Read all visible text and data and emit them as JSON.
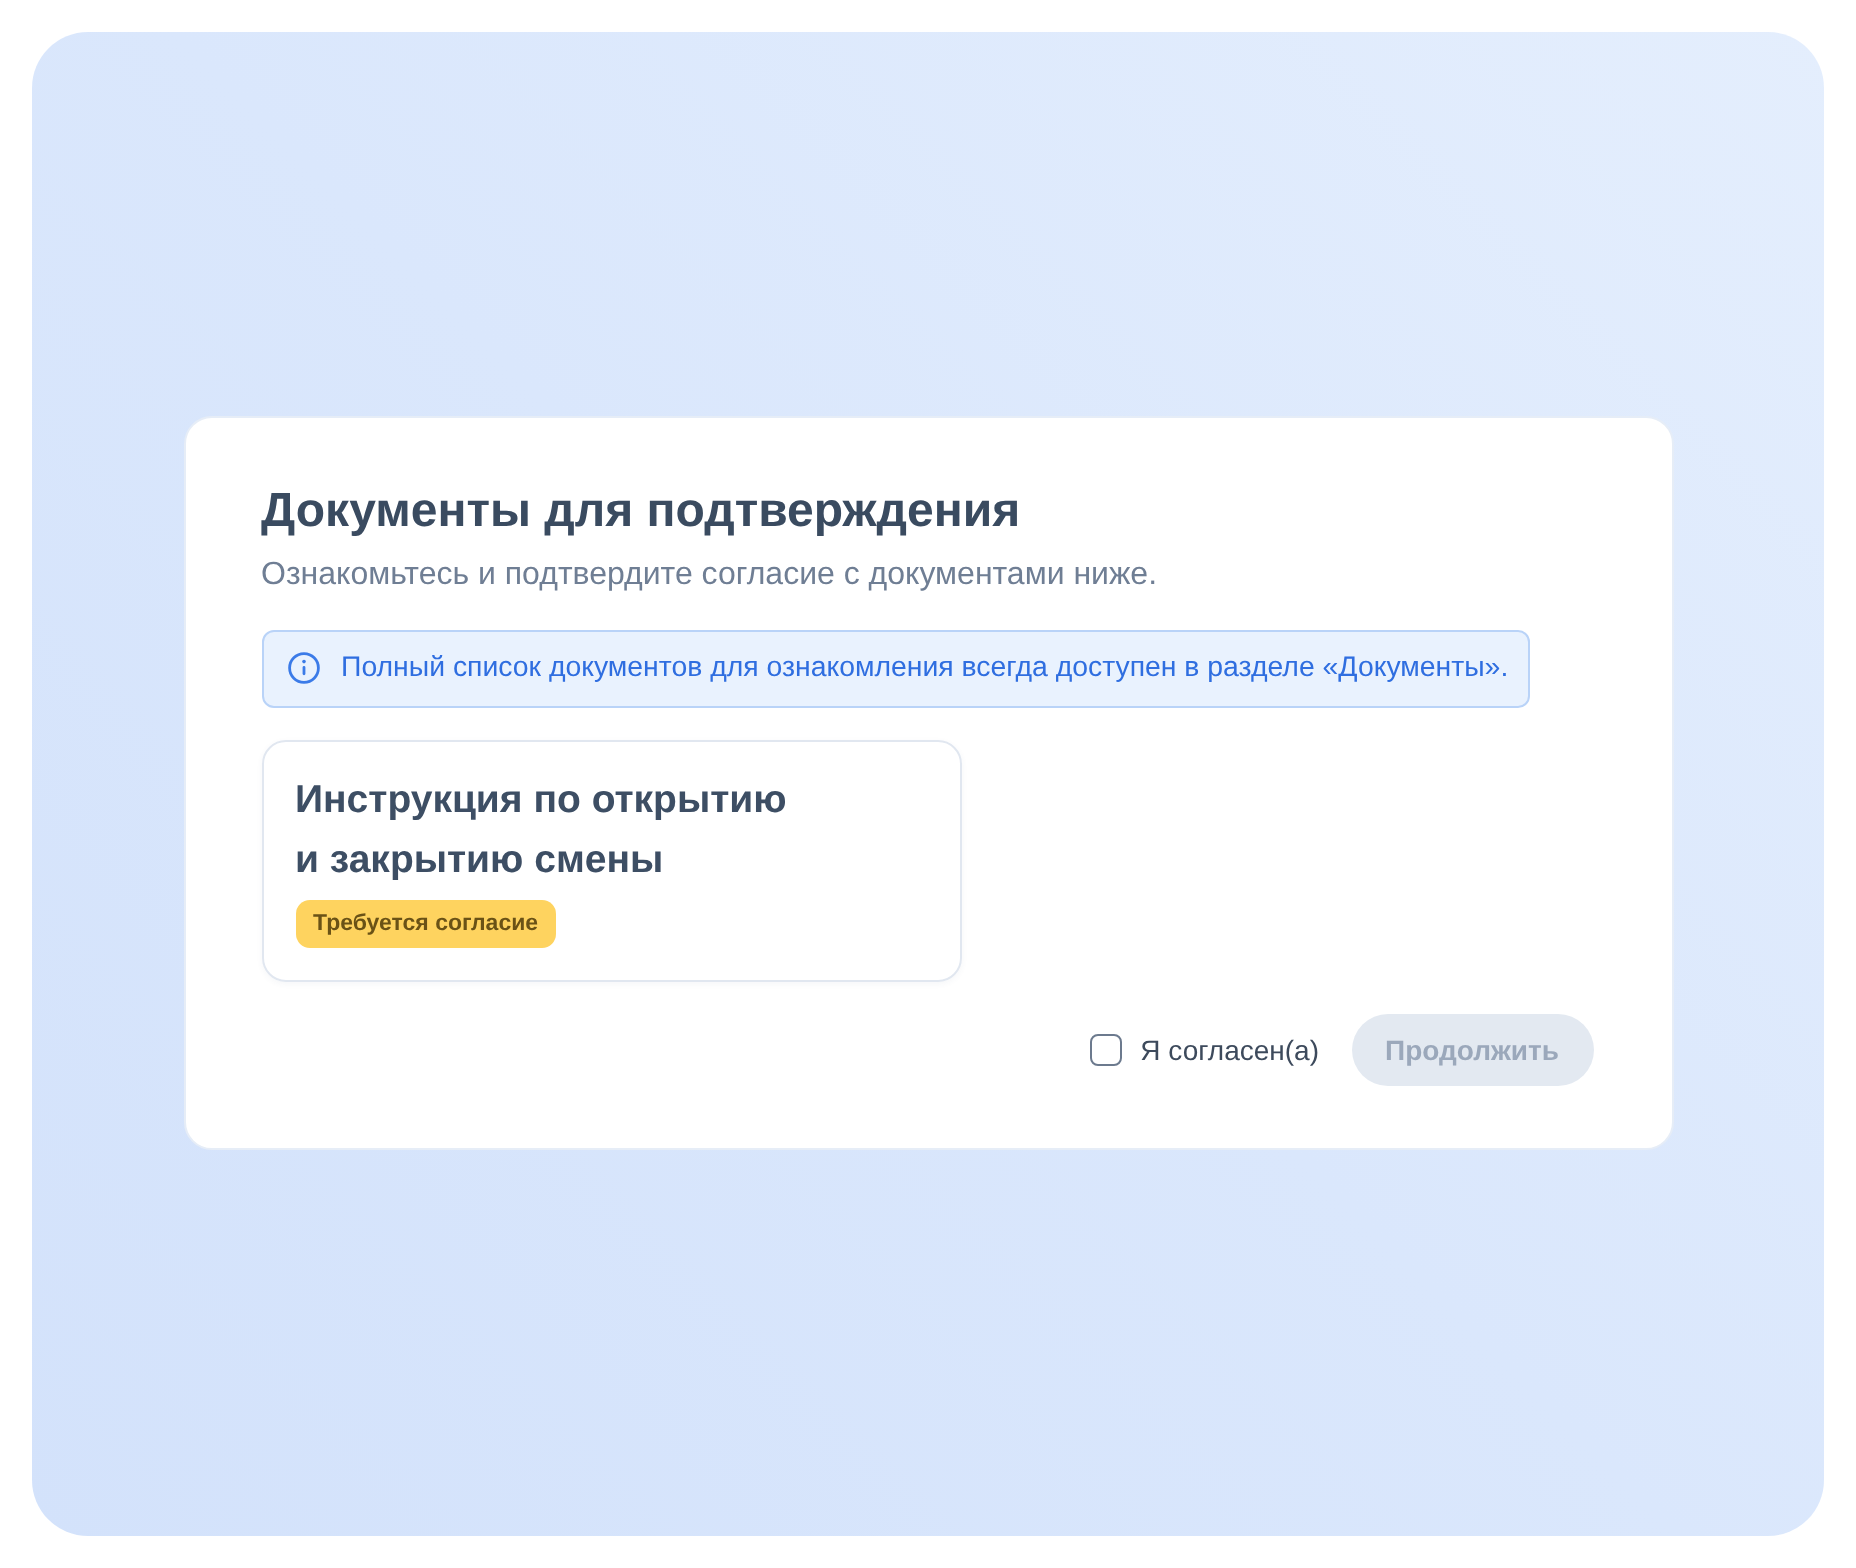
{
  "title": "Документы для подтверждения",
  "subtitle": "Ознакомьтесь и подтвердите согласие с документами ниже.",
  "notice": {
    "text": "Полный список документов для ознакомления всегда доступен в разделе «Документы»."
  },
  "documents": [
    {
      "title": "Инструкция по открытию и закрытию смены",
      "status": {
        "label": "Требуется согласие",
        "kind": "pending"
      }
    }
  ],
  "consent": {
    "label": "Я согласен(а)",
    "checked": false
  },
  "continue_button": {
    "label": "Продолжить",
    "disabled": true
  }
}
